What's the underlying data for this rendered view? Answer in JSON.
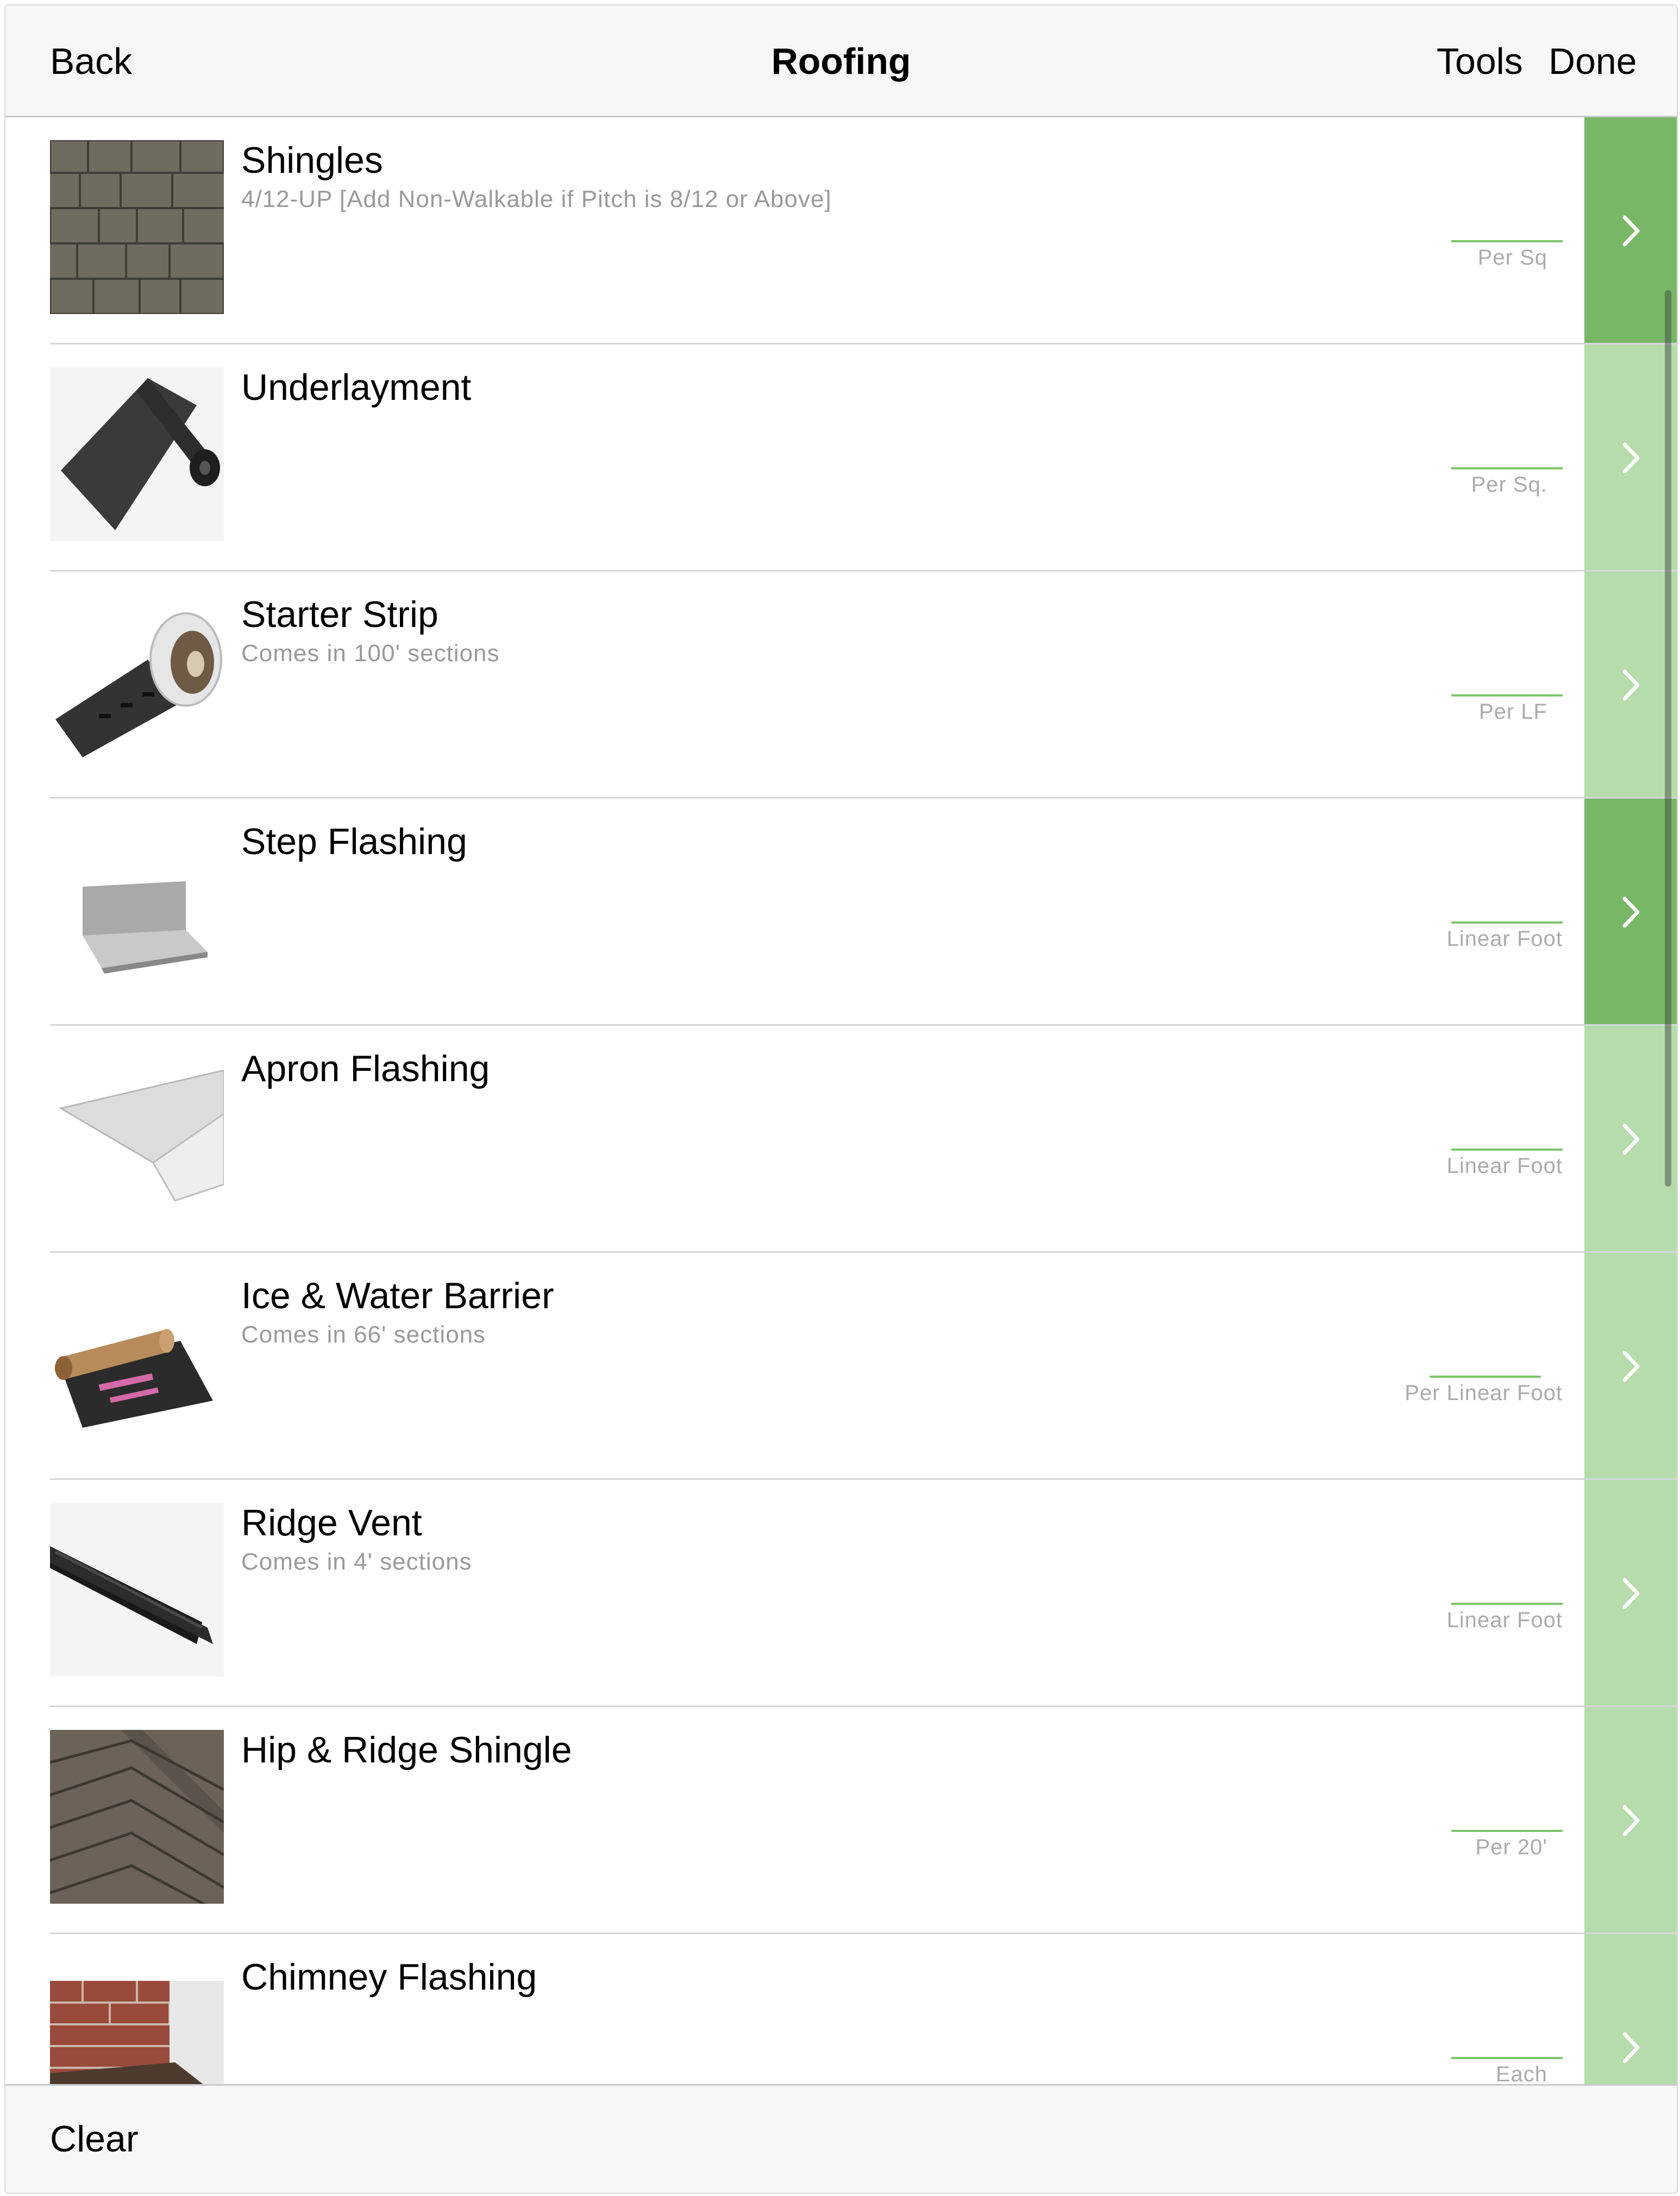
{
  "navbar": {
    "back_label": "Back",
    "title": "Roofing",
    "tools_label": "Tools",
    "done_label": "Done"
  },
  "items": [
    {
      "name": "Shingles",
      "note": "4/12-UP [Add Non-Walkable if Pitch is 8/12 or Above]",
      "unit": "Per Sq",
      "image": "shingles-image",
      "selected": true
    },
    {
      "name": "Underlayment",
      "note": "",
      "unit": "Per Sq.",
      "image": "underlayment-roll-image",
      "selected": false
    },
    {
      "name": "Starter Strip",
      "note": "Comes in 100' sections",
      "unit": "Per LF",
      "image": "starter-strip-roll-image",
      "selected": false
    },
    {
      "name": "Step Flashing",
      "note": "",
      "unit": "Linear Foot",
      "image": "step-flashing-image",
      "selected": true
    },
    {
      "name": "Apron Flashing",
      "note": "",
      "unit": "Linear Foot",
      "image": "apron-flashing-image",
      "selected": false
    },
    {
      "name": "Ice & Water Barrier",
      "note": "Comes in 66' sections",
      "unit": "Per Linear Foot",
      "image": "ice-water-barrier-image",
      "selected": false
    },
    {
      "name": "Ridge Vent",
      "note": "Comes in 4' sections",
      "unit": "Linear Foot",
      "image": "ridge-vent-image",
      "selected": false
    },
    {
      "name": "Hip & Ridge Shingle",
      "note": "",
      "unit": "Per 20'",
      "image": "hip-ridge-shingle-image",
      "selected": false
    },
    {
      "name": "Chimney Flashing",
      "note": "",
      "unit": "Each",
      "image": "chimney-flashing-image",
      "selected": false
    }
  ],
  "toolbar": {
    "clear_label": "Clear"
  },
  "colors": {
    "selected_accent": "#77b766",
    "unselected_accent": "#b5dcaa",
    "quantity_underline": "#7cc56a"
  }
}
